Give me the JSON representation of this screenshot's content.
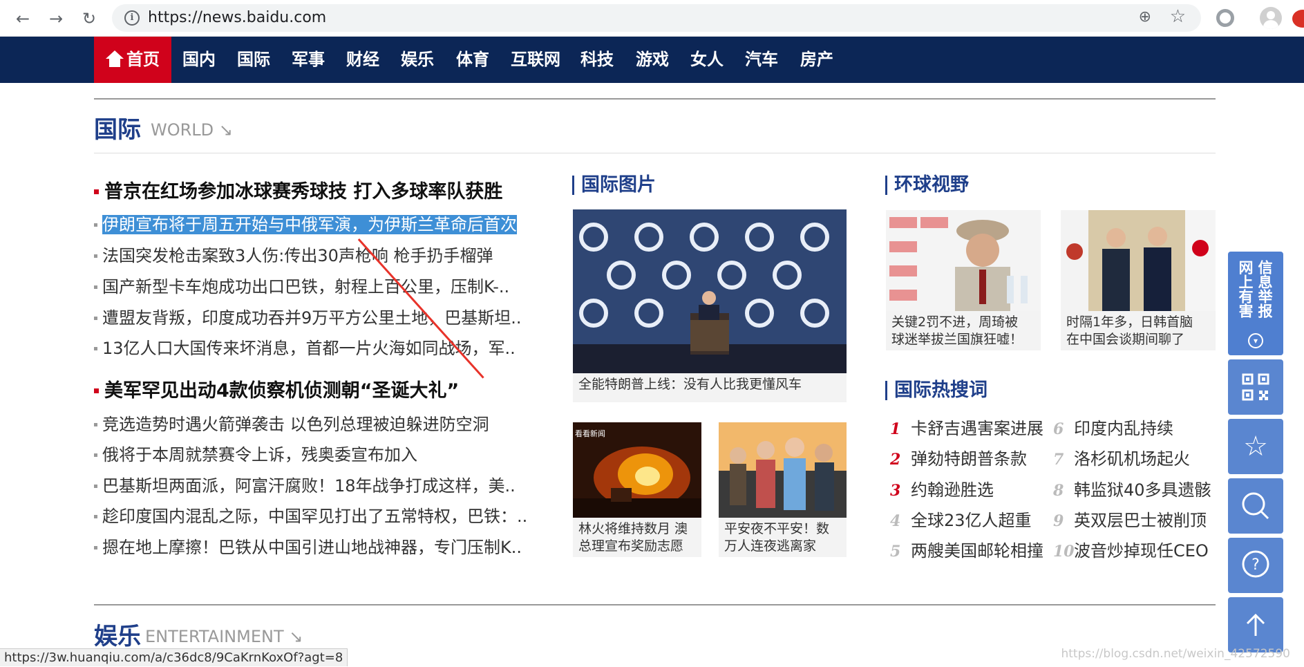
{
  "browser": {
    "url": "https://news.baidu.com"
  },
  "nav": {
    "home": "首页",
    "items": [
      "国内",
      "国际",
      "军事",
      "财经",
      "娱乐",
      "体育",
      "互联网",
      "科技",
      "游戏",
      "女人",
      "汽车",
      "房产"
    ]
  },
  "world": {
    "title": "国际",
    "subtitle": "WORLD ↘",
    "headline1": "普京在红场参加冰球赛秀球技 打入多球率队获胜",
    "list1": [
      "伊朗宣布将于周五开始与中俄军演，为伊斯兰革命后首次",
      "法国突发枪击案致3人伤:传出30声枪响 枪手扔手榴弹",
      "国产新型卡车炮成功出口巴铁，射程上百公里，压制K-..",
      "遭盟友背叛，印度成功吞并9万平方公里土地，巴基斯坦..",
      "13亿人口大国传来坏消息，首都一片火海如同战场，军.."
    ],
    "headline2": "美军罕见出动4款侦察机侦测朝“圣诞大礼”",
    "list2": [
      "竞选造势时遇火箭弹袭击 以色列总理被迫躲进防空洞",
      "俄将于本周就禁赛令上诉，残奥委宣布加入",
      "巴基斯坦两面派，阿富汗腐败！18年战争打成这样，美..",
      "趁印度国内混乱之际，中国罕见打出了五常特权，巴铁：..",
      "摁在地上摩擦！巴铁从中国引进山地战神器，专门压制K.."
    ]
  },
  "photos": {
    "title": "国际图片",
    "main_caption": "全能特朗普上线：没有人比我更懂风车",
    "small": [
      {
        "caption1": "林火将维持数月 澳",
        "caption2": "总理宣布奖励志愿",
        "tag": "看看新闻"
      },
      {
        "caption1": "平安夜不平安！数",
        "caption2": "万人连夜逃离家"
      }
    ]
  },
  "global_view": {
    "title": "环球视野",
    "items": [
      {
        "caption1": "关键2罚不进，周琦被",
        "caption2": "球迷举拔兰国旗狂嘘！"
      },
      {
        "caption1": "时隔1年多，日韩首脑",
        "caption2": "在中国会谈期间聊了"
      }
    ]
  },
  "hot_search": {
    "title": "国际热搜词",
    "left": [
      {
        "num": "1",
        "text": "卡舒吉遇害案进展"
      },
      {
        "num": "2",
        "text": "弹劾特朗普条款"
      },
      {
        "num": "3",
        "text": "约翰逊胜选"
      },
      {
        "num": "4",
        "text": "全球23亿人超重"
      },
      {
        "num": "5",
        "text": "两艘美国邮轮相撞"
      }
    ],
    "right": [
      {
        "num": "6",
        "text": "印度内乱持续"
      },
      {
        "num": "7",
        "text": "洛杉矶机场起火"
      },
      {
        "num": "8",
        "text": "韩监狱40多具遗骸"
      },
      {
        "num": "9",
        "text": "英双层巴士被削顶"
      },
      {
        "num": "10",
        "text": "波音炒掉现任CEO"
      }
    ]
  },
  "entertainment": {
    "title": "娱乐",
    "subtitle": "ENTERTAINMENT ↘"
  },
  "sidebar": {
    "report_col1": "网上有害",
    "report_col2": "信息举报"
  },
  "status_url": "https://3w.huanqiu.com/a/c36dc8/9CaKrnKoxOf?agt=8",
  "watermark": "https://blog.csdn.net/weixin_42572590"
}
